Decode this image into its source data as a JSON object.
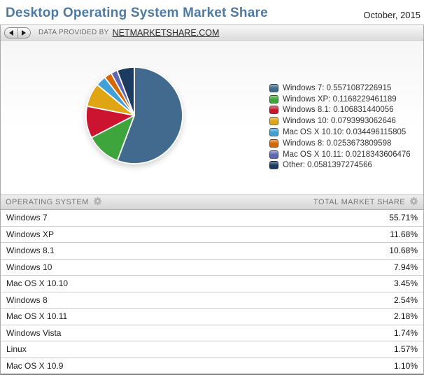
{
  "page": {
    "title": "Desktop Operating System Market Share",
    "date_label": "October, 2015"
  },
  "toolbar": {
    "provided_by_label": "DATA PROVIDED BY",
    "provider_link_label": "NETMARKETSHARE.COM",
    "prev_icon": "left-arrow",
    "next_icon": "right-arrow"
  },
  "chart_data": {
    "type": "pie",
    "title": "",
    "start_angle_deg": 0,
    "direction": "clockwise",
    "legend_position": "right",
    "slices": [
      {
        "name": "Windows 7",
        "share": 0.5571087226915,
        "color": "#426a8e",
        "legend_label": "Windows 7: 0.5571087226915"
      },
      {
        "name": "Windows XP",
        "share": 0.1168229461189,
        "color": "#3da53c",
        "legend_label": "Windows XP: 0.1168229461189"
      },
      {
        "name": "Windows 8.1",
        "share": 0.106831440056,
        "color": "#cc1430",
        "legend_label": "Windows 8.1: 0.106831440056"
      },
      {
        "name": "Windows 10",
        "share": 0.0793993062646,
        "color": "#dfa513",
        "legend_label": "Windows 10: 0.0793993062646"
      },
      {
        "name": "Mac OS X 10.10",
        "share": 0.034496115805,
        "color": "#41a0d6",
        "legend_label": "Mac OS X 10.10: 0.034496115805"
      },
      {
        "name": "Windows 8",
        "share": 0.0253673809598,
        "color": "#d96700",
        "legend_label": "Windows 8: 0.0253673809598"
      },
      {
        "name": "Mac OS X 10.11",
        "share": 0.0218343606476,
        "color": "#5c66b5",
        "legend_label": "Mac OS X 10.11: 0.0218343606476"
      },
      {
        "name": "Other",
        "share": 0.0581397274566,
        "color": "#1c3b60",
        "legend_label": "Other: 0.0581397274566"
      }
    ]
  },
  "table": {
    "columns": [
      {
        "label": "OPERATING SYSTEM",
        "icon": "gear"
      },
      {
        "label": "TOTAL MARKET SHARE",
        "icon": "gear"
      }
    ],
    "rows": [
      {
        "os": "Windows 7",
        "share": "55.71%"
      },
      {
        "os": "Windows XP",
        "share": "11.68%"
      },
      {
        "os": "Windows 8.1",
        "share": "10.68%"
      },
      {
        "os": "Windows 10",
        "share": "7.94%"
      },
      {
        "os": "Mac OS X 10.10",
        "share": "3.45%"
      },
      {
        "os": "Windows 8",
        "share": "2.54%"
      },
      {
        "os": "Mac OS X 10.11",
        "share": "2.18%"
      },
      {
        "os": "Windows Vista",
        "share": "1.74%"
      },
      {
        "os": "Linux",
        "share": "1.57%"
      },
      {
        "os": "Mac OS X 10.9",
        "share": "1.10%"
      }
    ]
  }
}
